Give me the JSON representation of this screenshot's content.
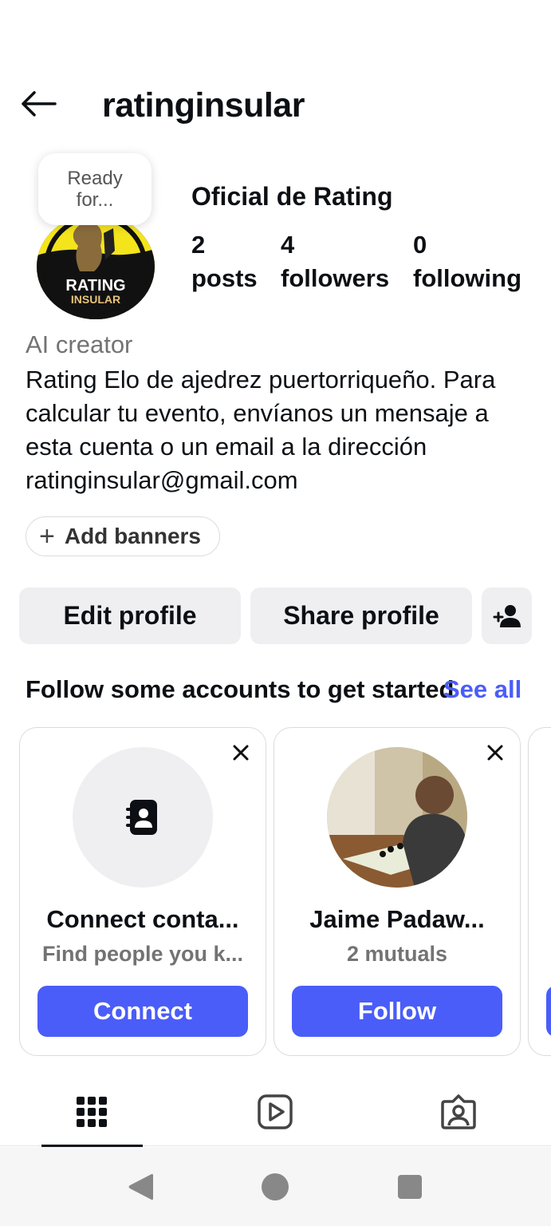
{
  "header": {
    "username": "ratinginsular"
  },
  "profile": {
    "note": "Ready for...",
    "avatar_text_top": "RATING",
    "avatar_text_bottom": "INSULAR",
    "display_name": "Oficial de Rating",
    "stats": {
      "posts_count": "2",
      "posts_label": "posts",
      "followers_count": "4",
      "followers_label": "followers",
      "following_count": "0",
      "following_label": "following"
    },
    "category": "AI creator",
    "bio": "Rating Elo de ajedrez puertorriqueño. Para calcular tu evento, envíanos un mensaje a esta cuenta o un email a la dirección ratinginsular@gmail.com",
    "add_banners_label": "Add banners"
  },
  "actions": {
    "edit_profile": "Edit profile",
    "share_profile": "Share profile"
  },
  "suggestions": {
    "title": "Follow some accounts to get started",
    "see_all": "See all",
    "cards": [
      {
        "title": "Connect conta...",
        "subtitle": "Find people you k...",
        "cta": "Connect"
      },
      {
        "title": "Jaime Padaw...",
        "subtitle": "2 mutuals",
        "cta": "Follow"
      }
    ]
  },
  "tabs": [
    "grid-tab",
    "reels-tab",
    "tagged-tab"
  ],
  "colors": {
    "accent": "#4a5df9",
    "button_bg": "#efeff2",
    "muted_text": "#737373"
  }
}
